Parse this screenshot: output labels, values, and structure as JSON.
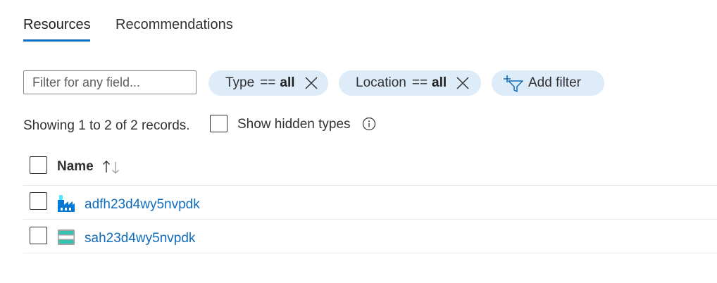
{
  "tabs": [
    {
      "label": "Resources",
      "active": true
    },
    {
      "label": "Recommendations",
      "active": false
    }
  ],
  "accent_color": "#0f6cbd",
  "filter": {
    "placeholder": "Filter for any field...",
    "value": ""
  },
  "pills": [
    {
      "field": "Type",
      "operator": "==",
      "value": "all",
      "icon": "close-icon"
    },
    {
      "field": "Location",
      "operator": "==",
      "value": "all",
      "icon": "close-icon"
    }
  ],
  "add_filter": {
    "label": "Add filter",
    "icon": "add-filter-icon"
  },
  "summary": "Showing 1 to 2 of 2 records.",
  "show_hidden": {
    "label": "Show hidden types",
    "checked": false,
    "icon": "info-icon"
  },
  "table": {
    "columns": [
      {
        "label": "Name",
        "sort": "ascending",
        "icon": "sort-icon"
      }
    ],
    "rows": [
      {
        "name": "adfh23d4wy5nvpdk",
        "icon": "data-factory-icon",
        "checked": false
      },
      {
        "name": "sah23d4wy5nvpdk",
        "icon": "storage-account-icon",
        "checked": false
      }
    ]
  }
}
